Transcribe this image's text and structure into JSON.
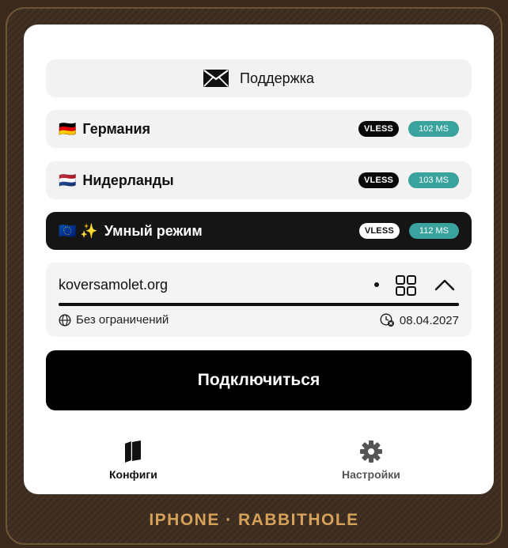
{
  "support": {
    "label": "Поддержка",
    "icon": "envelope-icon"
  },
  "servers": [
    {
      "flag": "🇩🇪",
      "name": "Германия",
      "protocol": "VLESS",
      "ping": "102 MS",
      "active": false
    },
    {
      "flag": "🇳🇱",
      "name": "Нидерланды",
      "protocol": "VLESS",
      "ping": "103 MS",
      "active": false
    },
    {
      "flag": "🇪🇺 ✨",
      "name": "Умный режим",
      "protocol": "VLESS",
      "ping": "112 MS",
      "active": true
    }
  ],
  "subscription": {
    "domain": "koversamolet.org",
    "traffic_used_fraction": 1.0,
    "limit_text": "Без ограничений",
    "expires": "08.04.2027"
  },
  "connect_label": "Подключиться",
  "tabs": {
    "configs": "Конфиги",
    "settings": "Настройки"
  },
  "caption": "IPHONE · RABBITHOLE",
  "colors": {
    "ping_badge": "#3aa39e",
    "caption": "#d6a25a",
    "background": "#3d2c1f"
  }
}
